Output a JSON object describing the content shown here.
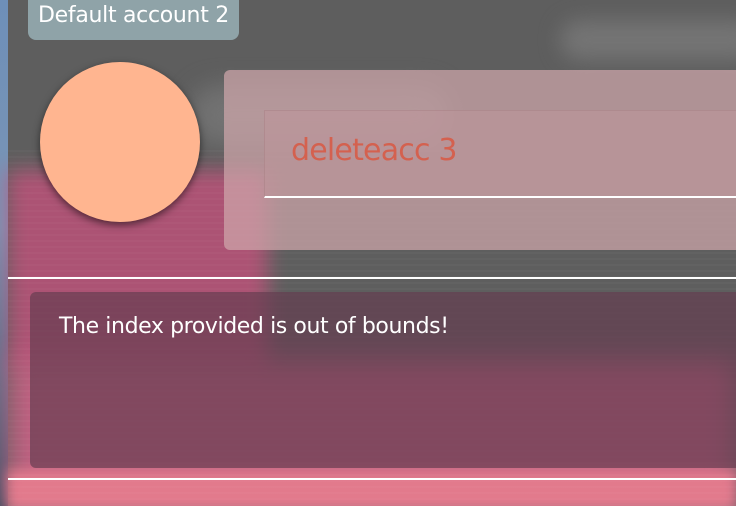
{
  "account": {
    "label": "Default account 2"
  },
  "command": {
    "value": "deleteacc 3"
  },
  "output": {
    "message": "The index provided is out of bounds!"
  },
  "colors": {
    "account_tag": "#8fa3a8",
    "avatar": "#ffb590",
    "command_text": "#d4614f",
    "input_panel": "#cfa6aa",
    "output_panel": "#643c50"
  }
}
